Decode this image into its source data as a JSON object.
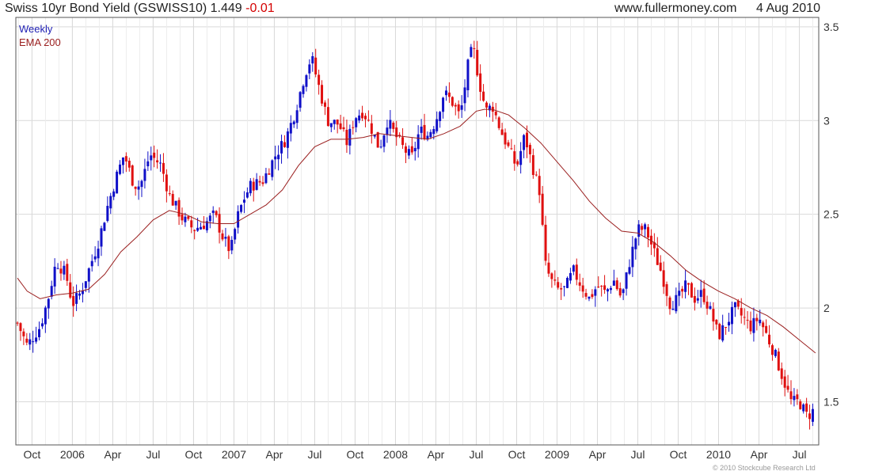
{
  "header": {
    "title_main": "Swiss 10yr Bond Yield (GSWISS10) 1.449",
    "title_change": "-0.01",
    "site": "www.fullermoney.com",
    "date": "4 Aug 2010"
  },
  "legend": {
    "weekly": "Weekly",
    "ema": "EMA 200"
  },
  "footer": {
    "copyright": "© 2010 Stockcube Research Ltd"
  },
  "colors": {
    "up": "#1010c8",
    "down": "#e01010",
    "ema": "#9b2020",
    "grid": "#d9d9d9"
  },
  "chart_data": {
    "type": "line",
    "subtype": "weekly-candlestick-with-ema",
    "ylim": [
      1.27,
      3.55
    ],
    "y_ticks": [
      1.5,
      2,
      2.5,
      3,
      3.5
    ],
    "y_tick_labels": [
      "1.5",
      "2",
      "2.5",
      "3",
      "3.5"
    ],
    "x_range": [
      2005.65,
      2010.62
    ],
    "x_ticks": [
      {
        "x": 2005.75,
        "label": "Oct"
      },
      {
        "x": 2006.0,
        "label": "2006"
      },
      {
        "x": 2006.25,
        "label": "Apr"
      },
      {
        "x": 2006.5,
        "label": "Jul"
      },
      {
        "x": 2006.75,
        "label": "Oct"
      },
      {
        "x": 2007.0,
        "label": "2007"
      },
      {
        "x": 2007.25,
        "label": "Apr"
      },
      {
        "x": 2007.5,
        "label": "Jul"
      },
      {
        "x": 2007.75,
        "label": "Oct"
      },
      {
        "x": 2008.0,
        "label": "2008"
      },
      {
        "x": 2008.25,
        "label": "Apr"
      },
      {
        "x": 2008.5,
        "label": "Jul"
      },
      {
        "x": 2008.75,
        "label": "Oct"
      },
      {
        "x": 2009.0,
        "label": "2009"
      },
      {
        "x": 2009.25,
        "label": "Apr"
      },
      {
        "x": 2009.5,
        "label": "Jul"
      },
      {
        "x": 2009.75,
        "label": "Oct"
      },
      {
        "x": 2010.0,
        "label": "2010"
      },
      {
        "x": 2010.25,
        "label": "Apr"
      },
      {
        "x": 2010.5,
        "label": "Jul"
      }
    ],
    "grid": true,
    "series_path": [
      [
        2005.66,
        1.92
      ],
      [
        2005.72,
        1.8
      ],
      [
        2005.8,
        1.9
      ],
      [
        2005.85,
        2.05
      ],
      [
        2005.9,
        2.25
      ],
      [
        2005.96,
        2.18
      ],
      [
        2006.0,
        2.02
      ],
      [
        2006.05,
        2.08
      ],
      [
        2006.1,
        2.2
      ],
      [
        2006.16,
        2.35
      ],
      [
        2006.22,
        2.55
      ],
      [
        2006.28,
        2.72
      ],
      [
        2006.32,
        2.82
      ],
      [
        2006.38,
        2.66
      ],
      [
        2006.42,
        2.65
      ],
      [
        2006.48,
        2.82
      ],
      [
        2006.55,
        2.76
      ],
      [
        2006.6,
        2.6
      ],
      [
        2006.68,
        2.48
      ],
      [
        2006.75,
        2.42
      ],
      [
        2006.82,
        2.45
      ],
      [
        2006.88,
        2.5
      ],
      [
        2006.93,
        2.38
      ],
      [
        2006.98,
        2.3
      ],
      [
        2007.02,
        2.48
      ],
      [
        2007.06,
        2.58
      ],
      [
        2007.1,
        2.65
      ],
      [
        2007.18,
        2.68
      ],
      [
        2007.26,
        2.82
      ],
      [
        2007.32,
        2.9
      ],
      [
        2007.38,
        3.05
      ],
      [
        2007.44,
        3.25
      ],
      [
        2007.48,
        3.34
      ],
      [
        2007.52,
        3.2
      ],
      [
        2007.58,
        3.0
      ],
      [
        2007.65,
        2.98
      ],
      [
        2007.7,
        2.88
      ],
      [
        2007.75,
        3.02
      ],
      [
        2007.8,
        3.05
      ],
      [
        2007.85,
        2.96
      ],
      [
        2007.9,
        2.85
      ],
      [
        2007.95,
        3.0
      ],
      [
        2008.0,
        2.92
      ],
      [
        2008.05,
        2.85
      ],
      [
        2008.1,
        2.8
      ],
      [
        2008.15,
        2.95
      ],
      [
        2008.2,
        2.92
      ],
      [
        2008.25,
        3.0
      ],
      [
        2008.3,
        3.15
      ],
      [
        2008.35,
        3.1
      ],
      [
        2008.4,
        3.02
      ],
      [
        2008.45,
        3.3
      ],
      [
        2008.48,
        3.4
      ],
      [
        2008.52,
        3.2
      ],
      [
        2008.56,
        3.05
      ],
      [
        2008.6,
        3.08
      ],
      [
        2008.65,
        2.95
      ],
      [
        2008.7,
        2.85
      ],
      [
        2008.75,
        2.75
      ],
      [
        2008.8,
        2.92
      ],
      [
        2008.85,
        2.75
      ],
      [
        2008.9,
        2.6
      ],
      [
        2008.92,
        2.25
      ],
      [
        2008.96,
        2.15
      ],
      [
        2009.0,
        2.1
      ],
      [
        2009.05,
        2.1
      ],
      [
        2009.1,
        2.2
      ],
      [
        2009.15,
        2.12
      ],
      [
        2009.2,
        2.05
      ],
      [
        2009.25,
        2.12
      ],
      [
        2009.3,
        2.08
      ],
      [
        2009.35,
        2.15
      ],
      [
        2009.4,
        2.05
      ],
      [
        2009.45,
        2.25
      ],
      [
        2009.5,
        2.42
      ],
      [
        2009.55,
        2.42
      ],
      [
        2009.6,
        2.3
      ],
      [
        2009.65,
        2.18
      ],
      [
        2009.7,
        2.02
      ],
      [
        2009.75,
        2.05
      ],
      [
        2009.8,
        2.12
      ],
      [
        2009.85,
        2.05
      ],
      [
        2009.9,
        2.08
      ],
      [
        2009.95,
        1.98
      ],
      [
        2010.0,
        1.85
      ],
      [
        2010.05,
        1.92
      ],
      [
        2010.1,
        2.0
      ],
      [
        2010.15,
        1.95
      ],
      [
        2010.2,
        1.9
      ],
      [
        2010.25,
        1.95
      ],
      [
        2010.3,
        1.85
      ],
      [
        2010.35,
        1.75
      ],
      [
        2010.4,
        1.62
      ],
      [
        2010.45,
        1.5
      ],
      [
        2010.5,
        1.5
      ],
      [
        2010.55,
        1.42
      ],
      [
        2010.58,
        1.45
      ],
      [
        2010.6,
        1.449
      ]
    ],
    "ema_200": [
      [
        2005.66,
        2.16
      ],
      [
        2005.72,
        2.09
      ],
      [
        2005.8,
        2.05
      ],
      [
        2005.9,
        2.07
      ],
      [
        2006.0,
        2.08
      ],
      [
        2006.1,
        2.1
      ],
      [
        2006.2,
        2.18
      ],
      [
        2006.3,
        2.3
      ],
      [
        2006.4,
        2.38
      ],
      [
        2006.5,
        2.47
      ],
      [
        2006.6,
        2.52
      ],
      [
        2006.7,
        2.5
      ],
      [
        2006.8,
        2.46
      ],
      [
        2006.9,
        2.45
      ],
      [
        2007.0,
        2.45
      ],
      [
        2007.1,
        2.5
      ],
      [
        2007.2,
        2.55
      ],
      [
        2007.3,
        2.63
      ],
      [
        2007.4,
        2.76
      ],
      [
        2007.5,
        2.86
      ],
      [
        2007.6,
        2.9
      ],
      [
        2007.7,
        2.9
      ],
      [
        2007.8,
        2.91
      ],
      [
        2007.9,
        2.93
      ],
      [
        2008.0,
        2.92
      ],
      [
        2008.1,
        2.91
      ],
      [
        2008.2,
        2.9
      ],
      [
        2008.3,
        2.93
      ],
      [
        2008.4,
        2.97
      ],
      [
        2008.5,
        3.05
      ],
      [
        2008.55,
        3.06
      ],
      [
        2008.6,
        3.06
      ],
      [
        2008.7,
        3.03
      ],
      [
        2008.8,
        2.96
      ],
      [
        2008.9,
        2.88
      ],
      [
        2009.0,
        2.78
      ],
      [
        2009.1,
        2.68
      ],
      [
        2009.2,
        2.57
      ],
      [
        2009.3,
        2.48
      ],
      [
        2009.4,
        2.41
      ],
      [
        2009.5,
        2.4
      ],
      [
        2009.6,
        2.35
      ],
      [
        2009.7,
        2.28
      ],
      [
        2009.8,
        2.2
      ],
      [
        2009.9,
        2.14
      ],
      [
        2010.0,
        2.09
      ],
      [
        2010.1,
        2.05
      ],
      [
        2010.2,
        2.0
      ],
      [
        2010.3,
        1.96
      ],
      [
        2010.4,
        1.9
      ],
      [
        2010.5,
        1.83
      ],
      [
        2010.6,
        1.76
      ]
    ]
  }
}
